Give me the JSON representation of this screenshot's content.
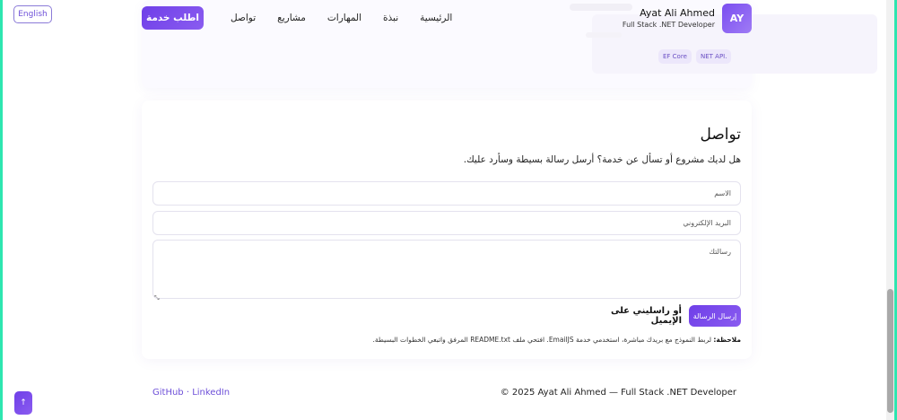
{
  "header": {
    "lang_button": "English",
    "avatar_initials": "AY",
    "name": "Ayat Ali Ahmed",
    "role": "Full Stack .NET Developer",
    "nav": [
      "الرئيسية",
      "نبذة",
      "المهارات",
      "مشاريع",
      "تواصل"
    ],
    "cta": "اطلب خدمة"
  },
  "skills": {
    "tags": [
      "NET API.",
      "EF Core"
    ]
  },
  "contact": {
    "title": "تواصل",
    "subtitle": "هل لديك مشروع أو تسأل عن خدمة؟ أرسل رسالة بسيطة وسأرد عليك.",
    "name_placeholder": "الاسم",
    "email_placeholder": "البريد الإلكتروني",
    "message_placeholder": "رسالتك",
    "send_button": "إرسال الرسالة",
    "email_link": "أو راسليني على الإيميل",
    "note_label": "ملاحظة:",
    "note_text": " لربط النموذج مع بريدك مباشرة، استخدمي خدمة EmailJS. افتحي ملف README.txt المرفق واتبعي الخطوات البسيطة."
  },
  "footer": {
    "links": "GitHub · LinkedIn",
    "copyright": "© 2025 Ayat Ali Ahmed — Full Stack .NET Developer"
  },
  "icons": {
    "scroll_top": "arrow-up-icon",
    "resize": "resize-handle-icon"
  },
  "colors": {
    "accent": "#7a4df0",
    "frame": "#2ee6b0"
  }
}
